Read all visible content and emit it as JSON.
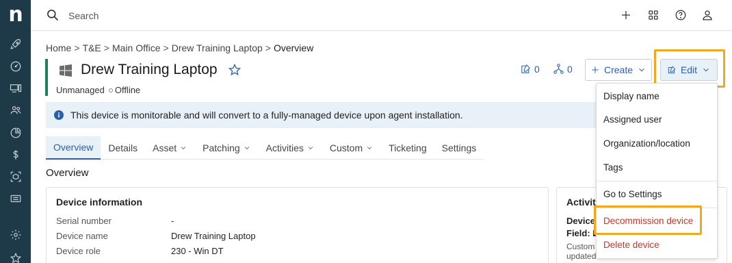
{
  "sidebar": {
    "logo": "n",
    "items": [
      {
        "icon": "rocket-icon"
      },
      {
        "icon": "gauge-icon"
      },
      {
        "icon": "devices-icon"
      },
      {
        "icon": "users-icon"
      },
      {
        "icon": "pie-chart-icon"
      },
      {
        "icon": "dollar-icon"
      },
      {
        "icon": "box-icon"
      },
      {
        "icon": "ticket-icon"
      },
      {
        "icon": "gear-icon"
      },
      {
        "icon": "star-icon"
      }
    ]
  },
  "topbar": {
    "search_placeholder": "Search",
    "icons": [
      "plus-icon",
      "apps-grid-icon",
      "help-icon",
      "user-icon"
    ]
  },
  "breadcrumb": {
    "items": [
      "Home",
      "T&E",
      "Main Office",
      "Drew Training Laptop"
    ],
    "current": "Overview",
    "separator": ">"
  },
  "device": {
    "title": "Drew Training Laptop",
    "management": "Unmanaged",
    "status": "Offline"
  },
  "counters": {
    "tasks": "0",
    "relations": "0"
  },
  "buttons": {
    "create": "Create",
    "edit": "Edit"
  },
  "banner": {
    "text": "This device is monitorable and will convert to a fully-managed device upon agent installation."
  },
  "tabs": [
    {
      "label": "Overview",
      "active": true,
      "has_menu": false
    },
    {
      "label": "Details",
      "active": false,
      "has_menu": false
    },
    {
      "label": "Asset",
      "active": false,
      "has_menu": true
    },
    {
      "label": "Patching",
      "active": false,
      "has_menu": true
    },
    {
      "label": "Activities",
      "active": false,
      "has_menu": true
    },
    {
      "label": "Custom",
      "active": false,
      "has_menu": true
    },
    {
      "label": "Ticketing",
      "active": false,
      "has_menu": false
    },
    {
      "label": "Settings",
      "active": false,
      "has_menu": false
    }
  ],
  "overview": {
    "section_title": "Overview",
    "device_info": {
      "title": "Device information",
      "fields": [
        {
          "label": "Serial number",
          "value": "-"
        },
        {
          "label": "Device name",
          "value": "Drew Training Laptop"
        },
        {
          "label": "Device role",
          "value": "230 - Win DT"
        }
      ]
    },
    "activity": {
      "title": "Activit",
      "lines": [
        "Device",
        "Field: D",
        "Custom",
        "updated"
      ]
    }
  },
  "edit_menu": {
    "items": [
      {
        "label": "Display name",
        "danger": false
      },
      {
        "label": "Assigned user",
        "danger": false
      },
      {
        "label": "Organization/location",
        "danger": false
      },
      {
        "label": "Tags",
        "danger": false
      },
      {
        "label": "Go to Settings",
        "danger": false
      },
      {
        "label": "Decommission device",
        "danger": true
      },
      {
        "label": "Delete device",
        "danger": true
      }
    ]
  },
  "colors": {
    "sidebar_bg": "#1e3947",
    "accent_blue": "#2c5fa8",
    "highlight": "#f2a81d",
    "danger": "#c0392b",
    "title_accent": "#1f7f5a"
  }
}
